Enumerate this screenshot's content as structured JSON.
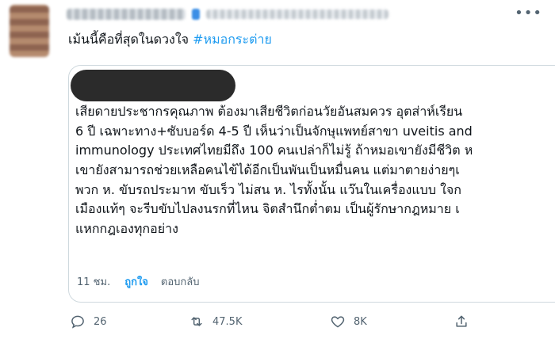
{
  "tweet": {
    "text": "เม้นนี้คือที่สุดในดวงใจ",
    "hashtag": "#หมอกระต่าย"
  },
  "quote": {
    "lines": [
      "เสียดายประชากรคุณภาพ ต้องมาเสียชีวิตก่อนวัยอันสมควร อุตส่าห์เรียน",
      "6 ปี เฉพาะทาง+ซับบอร์ด 4-5 ปี เห็นว่าเป็นจักษุแพทย์สาขา uveitis and",
      "immunology ประเทศไทยมีถึง 100 คนเปล่าก็ไม่รู้ ถ้าหมอเขายังมีชีวิต ห",
      "เขายังสามารถช่วยเหลือคนไข้ได้อีกเป็นพันเป็นหมื่นคน แต่มาตายง่ายๆเ",
      "พวก ห. ขับรถประมาท ขับเร็ว ไม่สน ห. ไรทั้งนั้น แว๊นในเครื่องแบบ ใจก",
      "เมืองแท้ๆ จะรีบขับไปลงนรกที่ไหน จิตสำนึกต่ำตม เป็นผู้รักษากฎหมาย เ",
      "แหกกฎเองทุกอย่าง"
    ],
    "time": "11 ชม.",
    "like_label": "ถูกใจ",
    "reply_label": "ตอบกลับ"
  },
  "actions": {
    "replies": "26",
    "retweets": "47.5K",
    "likes": "8K"
  },
  "icons": [
    "more-icon",
    "reply-icon",
    "retweet-icon",
    "like-icon",
    "share-icon"
  ],
  "colors": {
    "accent": "#1d9bf0",
    "muted": "#536471",
    "border": "#cfd9de"
  }
}
